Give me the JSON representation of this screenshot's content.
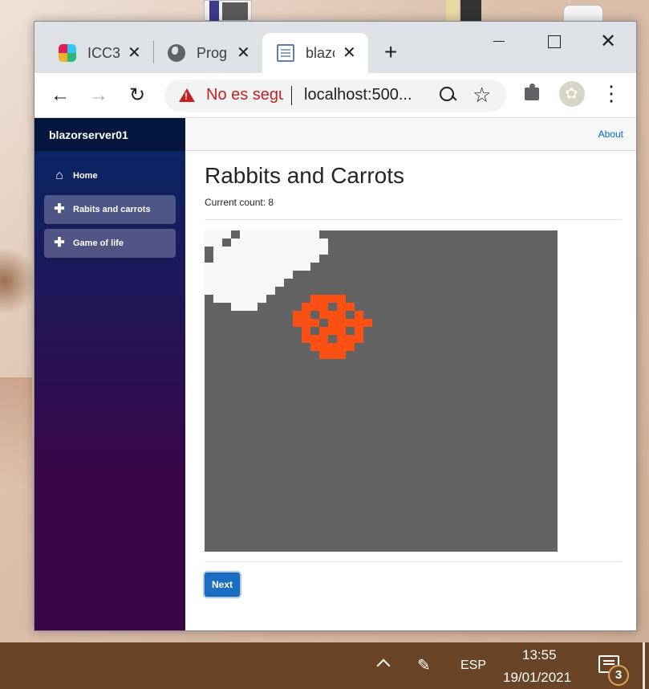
{
  "browser": {
    "tabs": [
      {
        "title": "ICC3",
        "icon": "slack-icon",
        "active": false
      },
      {
        "title": "Prog",
        "icon": "globe-icon",
        "active": false
      },
      {
        "title": "blazo",
        "icon": "document-icon",
        "active": true
      }
    ],
    "new_tab_symbol": "+",
    "close_symbol": "✕",
    "address_bar": {
      "security_text": "No es segu",
      "url": "localhost:500..."
    }
  },
  "app": {
    "brand": "blazorserver01",
    "nav": [
      {
        "label": "Home",
        "icon": "home-icon"
      },
      {
        "label": "Rabits and carrots",
        "icon": "plus-icon",
        "active": true
      },
      {
        "label": "Game of life",
        "icon": "plus-icon"
      }
    ],
    "top_link": "About",
    "page_title": "Rabbits and Carrots",
    "count_label": "Current count:",
    "count_value": "8",
    "next_button": "Next",
    "grid": {
      "columns": 40,
      "rows": 40,
      "background_color": "#636363",
      "rabbit_color": "#f7f7f7",
      "carrot_color": "#fa5014"
    }
  },
  "taskbar": {
    "language": "ESP",
    "time": "13:55",
    "date": "19/01/2021",
    "notification_count": "3"
  }
}
